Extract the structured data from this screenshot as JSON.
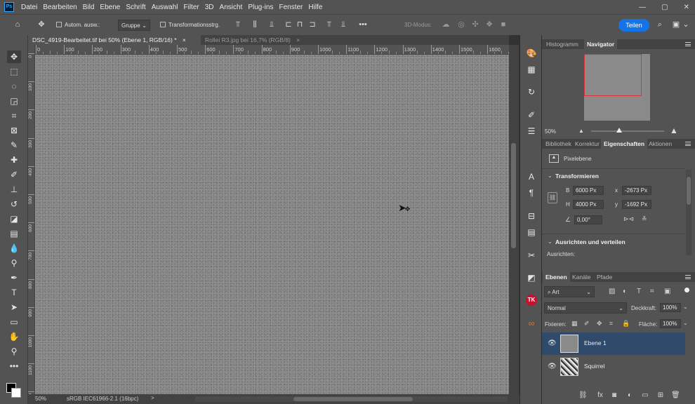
{
  "menubar": {
    "logo": "Ps",
    "items": [
      "Datei",
      "Bearbeiten",
      "Bild",
      "Ebene",
      "Schrift",
      "Auswahl",
      "Filter",
      "3D",
      "Ansicht",
      "Plug-ins",
      "Fenster",
      "Hilfe"
    ]
  },
  "options": {
    "auto_select_label": "Autom. ausw.:",
    "auto_select_value": "Gruppe",
    "transform_label": "Transformationsstrg.",
    "mode_3d": "3D-Modus:",
    "share_label": "Teilen",
    "more": "•••"
  },
  "tabs": [
    {
      "label": "DSC_4919-Bearbeitet.tif bei 50% (Ebene 1, RGB/16) *",
      "close": "×"
    },
    {
      "label": "Rollei R3.jpg bei 16,7% (RGB/8)",
      "close": "×"
    }
  ],
  "ruler": {
    "labels": [
      "0",
      "100",
      "200",
      "300",
      "400",
      "500",
      "600",
      "700",
      "800",
      "900",
      "1000",
      "1100",
      "1200",
      "1300",
      "1400",
      "1500",
      "1600"
    ]
  },
  "status": {
    "zoom": "50%",
    "profile": "sRGB IEC61966-2.1 (16bpc)",
    "arrow": ">"
  },
  "navigator": {
    "tabs": [
      "Histogramm",
      "Navigator"
    ],
    "active_tab": "Navigator",
    "zoom": "50%",
    "zoom_slider_fraction": 0.38
  },
  "properties": {
    "tabs": [
      "Bibliothek",
      "Korrektur",
      "Eigenschaften",
      "Aktionen"
    ],
    "active_tab": "Eigenschaften",
    "layer_type": "Pixelebene",
    "transform_heading": "Transformieren",
    "width_label": "B",
    "width_value": "6000 Px",
    "height_label": "H",
    "height_value": "4000 Px",
    "x_label": "x",
    "x_value": "-2673 Px",
    "y_label": "y",
    "y_value": "-1692 Px",
    "angle_value": "0,00°",
    "align_heading": "Ausrichten und verteilen",
    "align_label": "Ausrichten:"
  },
  "layers": {
    "tabs": [
      "Ebenen",
      "Kanäle",
      "Pfade"
    ],
    "active_tab": "Ebenen",
    "filter_kind": "Art",
    "blend_mode": "Normal",
    "opacity_label": "Deckkraft:",
    "opacity_value": "100%",
    "lock_label": "Fixieren:",
    "fill_label": "Fläche:",
    "fill_value": "100%",
    "items": [
      {
        "name": "Ebene 1",
        "selected": true
      },
      {
        "name": "Squirrel",
        "selected": false
      }
    ]
  },
  "colors": {
    "accent": "#1473e6",
    "selection": "#2f4a6b",
    "nav_frame": "#e0303a"
  }
}
